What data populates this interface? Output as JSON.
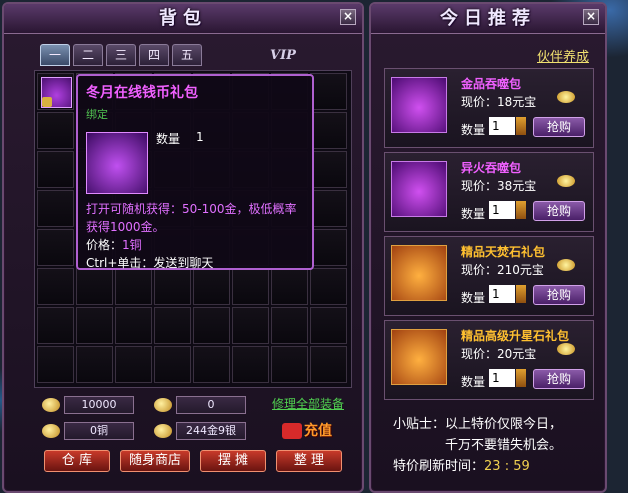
{
  "bag": {
    "title": "背包",
    "close": "×",
    "tabs": [
      "一",
      "二",
      "三",
      "四",
      "五"
    ],
    "vip_tab": "VIP",
    "tooltip": {
      "name": "冬月在线钱币礼包",
      "bound": "绑定",
      "qty_label": "数量",
      "qty_value": "1",
      "desc": "打开可随机获得：50-100金，极低概率获得1000金。",
      "price_label": "价格：",
      "price_value": "1铜",
      "ctrl": "Ctrl+单击：发送到聊天"
    },
    "money": {
      "gold_bound": "10000",
      "gold": "0",
      "copper": "0铜",
      "total": "244金9银"
    },
    "fix_link": "修理全部装备",
    "recharge": "充值",
    "buttons": [
      "仓 库",
      "随身商店",
      "摆 摊",
      "整 理"
    ]
  },
  "recommend": {
    "title": "今日推荐",
    "close": "×",
    "partner_link": "伙伴养成",
    "items": [
      {
        "name": "金品吞噬包",
        "price": "现价：18元宝",
        "qty_label": "数量",
        "qty": "1",
        "buy": "抢购",
        "style": "purple"
      },
      {
        "name": "异火吞噬包",
        "price": "现价：38元宝",
        "qty_label": "数量",
        "qty": "1",
        "buy": "抢购",
        "style": "purple"
      },
      {
        "name": "精品天焚石礼包",
        "price": "现价：210元宝",
        "qty_label": "数量",
        "qty": "1",
        "buy": "抢购",
        "style": "orange"
      },
      {
        "name": "精品高级升星石礼包",
        "price": "现价：20元宝",
        "qty_label": "数量",
        "qty": "1",
        "buy": "抢购",
        "style": "orange"
      }
    ],
    "tip_line1": "小贴士：以上特价仅限今日，",
    "tip_line2": "千万不要错失机会。",
    "refresh_label": "特价刷新时间：",
    "refresh_time": "23 : 59"
  }
}
